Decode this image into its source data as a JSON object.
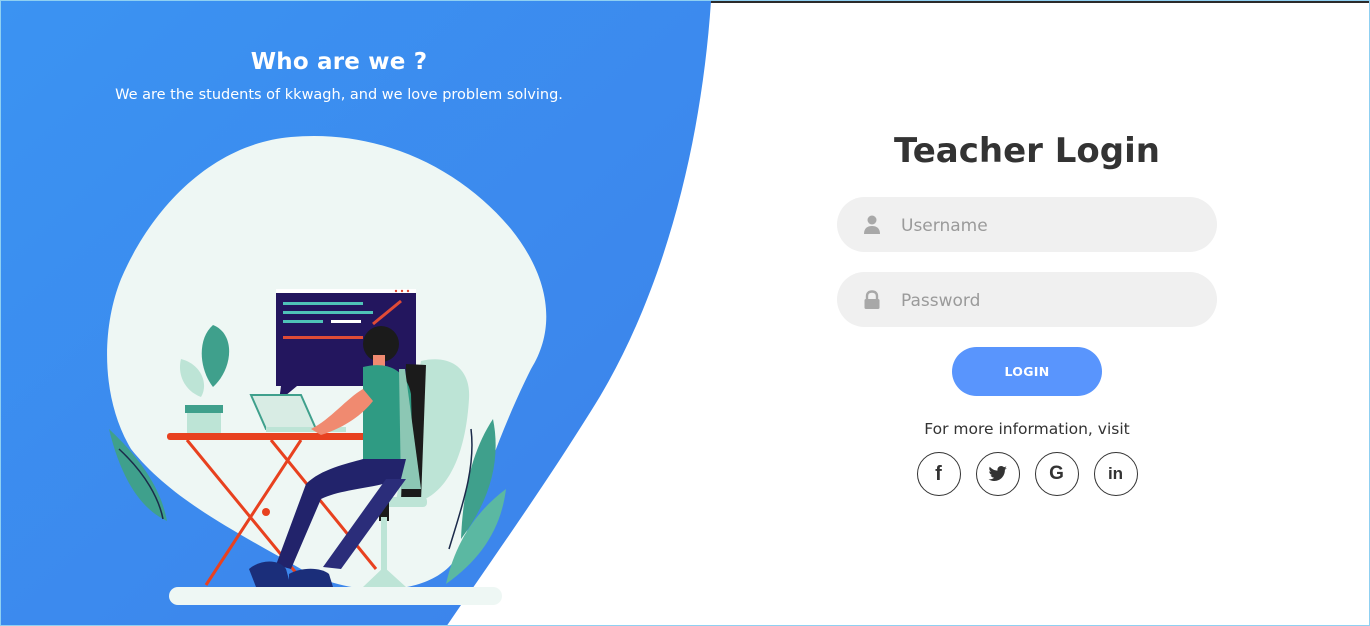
{
  "left": {
    "title": "Who are we ?",
    "subtitle": "We are the students of kkwagh, and we love problem solving."
  },
  "login": {
    "title": "Teacher Login",
    "username_placeholder": "Username",
    "password_placeholder": "Password",
    "button_label": "LOGIN",
    "info_text": "For more information, visit"
  },
  "socials": [
    {
      "name": "facebook-icon",
      "glyph": "f"
    },
    {
      "name": "twitter-icon",
      "glyph": ""
    },
    {
      "name": "google-icon",
      "glyph": "G"
    },
    {
      "name": "linkedin-icon",
      "glyph": "in"
    }
  ],
  "colors": {
    "blue_start": "#3a8ff2",
    "blue_end": "#3d84ea",
    "button": "#5995fd",
    "field_bg": "#f0f0f0",
    "title": "#333333"
  }
}
